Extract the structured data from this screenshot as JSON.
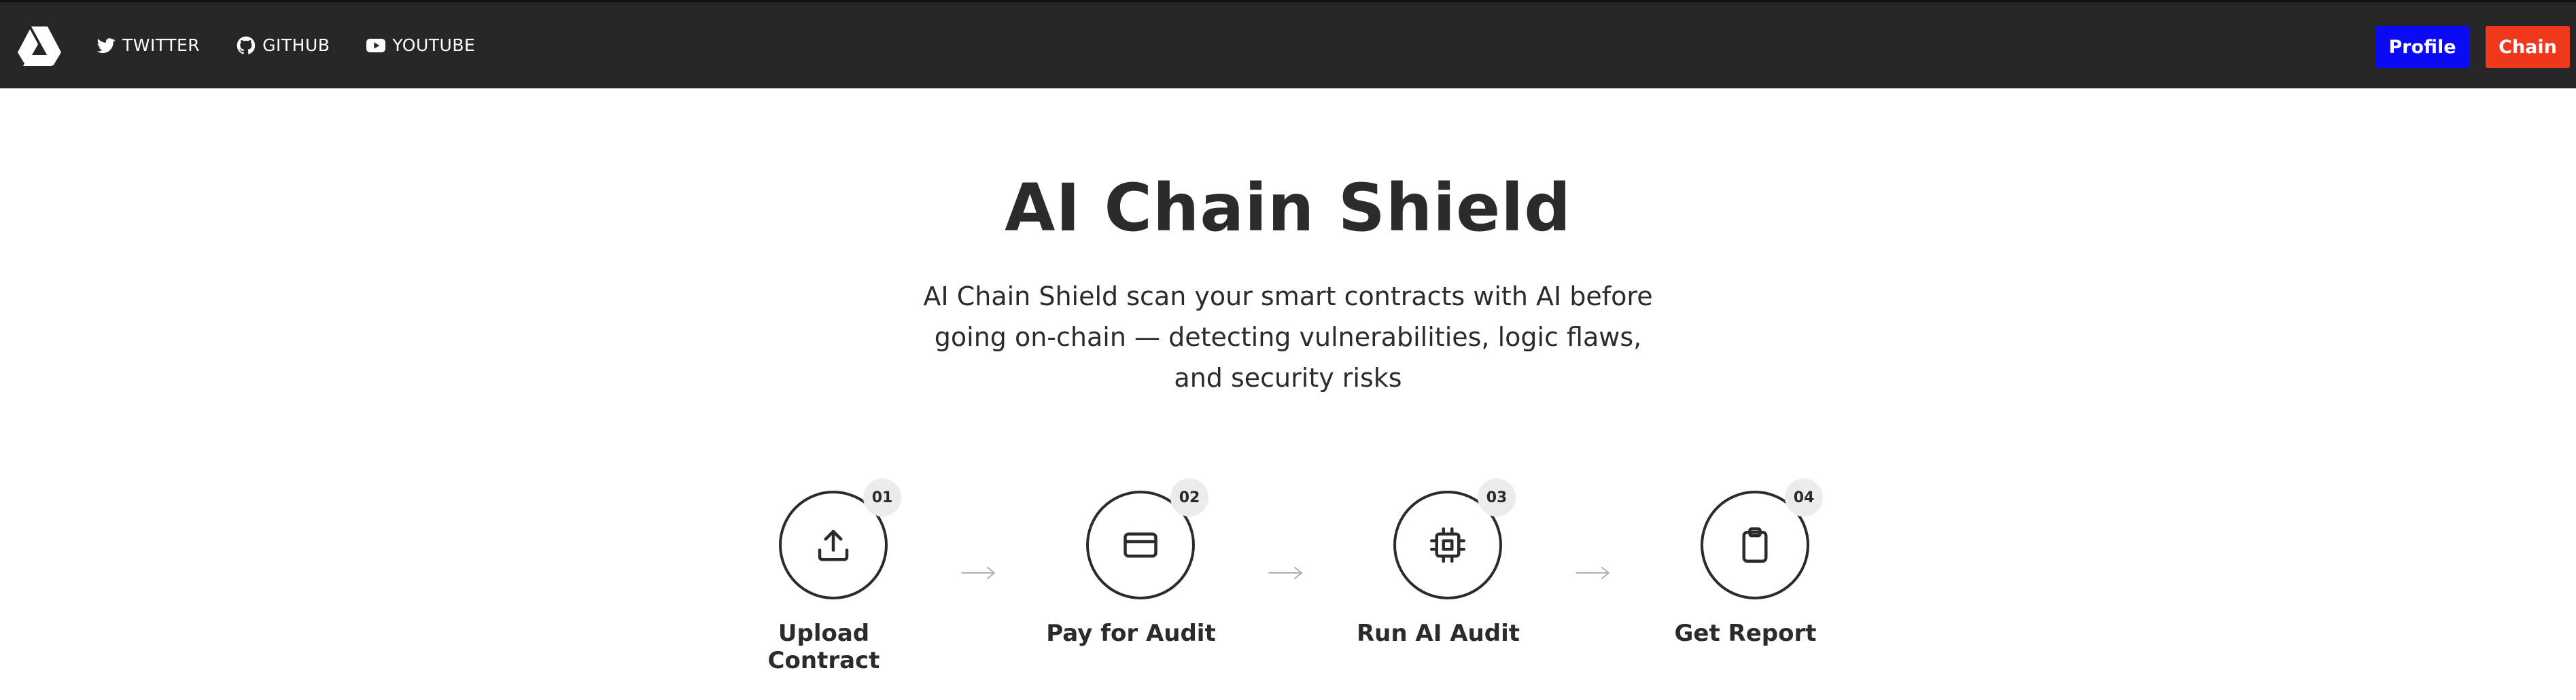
{
  "nav": {
    "links": [
      {
        "label": "TWITTER",
        "icon": "twitter-icon"
      },
      {
        "label": "GITHUB",
        "icon": "github-icon"
      },
      {
        "label": "YOUTUBE",
        "icon": "youtube-icon"
      }
    ],
    "logo_icon": "triangle-logo-icon",
    "profile_label": "Profile",
    "chain_label": "Chain"
  },
  "hero": {
    "title": "AI Chain Shield",
    "description": "AI Chain Shield scan your smart contracts with AI before going on-chain — detecting vulnerabilities, logic flaws, and security risks"
  },
  "steps": [
    {
      "number": "01",
      "label": "Upload Contract",
      "icon": "upload-icon"
    },
    {
      "number": "02",
      "label": "Pay for Audit",
      "icon": "credit-card-icon"
    },
    {
      "number": "03",
      "label": "Run AI Audit",
      "icon": "cpu-chip-icon"
    },
    {
      "number": "04",
      "label": "Get Report",
      "icon": "clipboard-icon"
    }
  ],
  "colors": {
    "topbar": "#262626",
    "profile_button": "#0a0af5",
    "chain_button": "#f0391c",
    "text": "#2b2b2b",
    "badge": "#ececec",
    "arrow": "#b0b0b0"
  }
}
